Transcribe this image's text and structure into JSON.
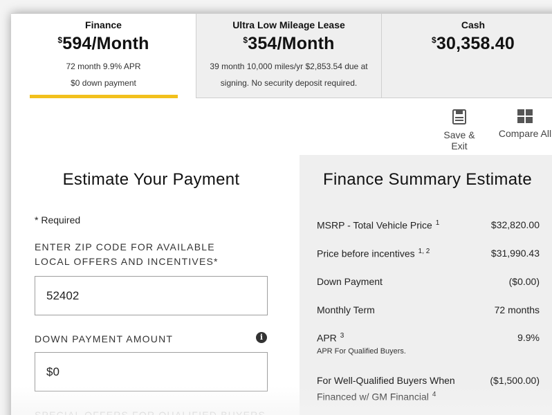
{
  "tabs": [
    {
      "name": "Finance",
      "currency": "$",
      "price": "594/Month",
      "desc_line1": "72 month 9.9% APR",
      "desc_line2": "$0 down payment"
    },
    {
      "name": "Ultra Low Mileage Lease",
      "currency": "$",
      "price": "354/Month",
      "desc_line1": "39 month 10,000 miles/yr $2,853.54 due at",
      "desc_line2": "signing. No security deposit required."
    },
    {
      "name": "Cash",
      "currency": "$",
      "price": "30,358.40"
    }
  ],
  "actions": {
    "save_label": "Save & Exit",
    "compare_label": "Compare All"
  },
  "estimate": {
    "title": "Estimate Your Payment",
    "required_note": "* Required",
    "zip_label": "ENTER ZIP CODE FOR AVAILABLE LOCAL OFFERS AND INCENTIVES*",
    "zip_value": "52402",
    "down_label": "DOWN PAYMENT AMOUNT",
    "down_value": "$0",
    "next_label_partial": "SPECIAL OFFERS FOR QUALIFIED BUYERS"
  },
  "summary": {
    "title": "Finance Summary Estimate",
    "rows": [
      {
        "label": "MSRP - Total Vehicle Price",
        "sup": "1",
        "value": "$32,820.00"
      },
      {
        "label": "Price before incentives",
        "sup": "1, 2",
        "value": "$31,990.43"
      },
      {
        "label": "Down Payment",
        "sup": "",
        "value": "($0.00)"
      },
      {
        "label": "Monthly Term",
        "sup": "",
        "value": "72 months"
      },
      {
        "label": "APR",
        "sup": "3",
        "value": "9.9%",
        "sub": "APR For Qualified Buyers."
      },
      {
        "label": "For Well-Qualified Buyers When",
        "sup": "",
        "value": "($1,500.00)",
        "label2": "Financed w/ GM Financial",
        "sup2": "4"
      }
    ]
  },
  "colors": {
    "accent": "#f2c01c",
    "summary_bg": "#efefef",
    "tab_inactive_bg": "#efefef"
  },
  "icons": {
    "save": "floppy-disk-icon",
    "compare": "grid-icon",
    "info": "info-icon"
  }
}
